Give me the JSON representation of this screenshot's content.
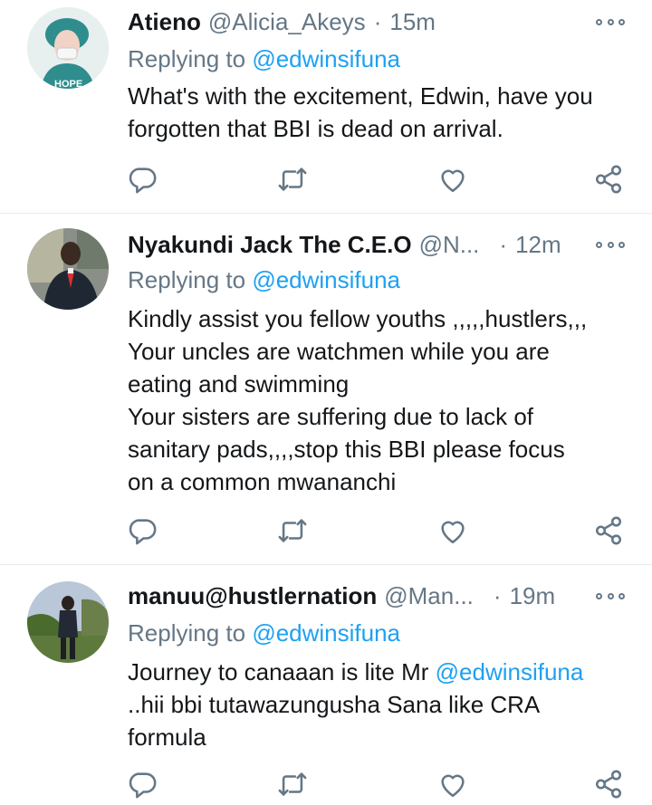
{
  "tweets": [
    {
      "name": "Atieno",
      "handle": "@Alicia_Akeys",
      "separator": "·",
      "time": "15m",
      "replying_prefix": "Replying to",
      "replying_to": "@edwinsifuna",
      "body_lines": [
        "What's with the excitement, Edwin, have you",
        "forgotten that BBI is dead on arrival."
      ],
      "avatar_badge": "HOPE"
    },
    {
      "name": "Nyakundi Jack The C.E.O",
      "handle": "@N...",
      "separator": "·",
      "time": "12m",
      "replying_prefix": "Replying to",
      "replying_to": "@edwinsifuna",
      "body_lines": [
        "Kindly assist you fellow youths ,,,,,hustlers,,,",
        "Your uncles are watchmen while you are",
        "eating and swimming",
        "Your sisters are suffering due to lack of",
        "sanitary pads,,,,stop this BBI please focus",
        "on a common mwananchi"
      ]
    },
    {
      "name": "manuu@hustlernation",
      "handle": "@Man...",
      "separator": "·",
      "time": "19m",
      "replying_prefix": "Replying to",
      "replying_to": "@edwinsifuna",
      "body_line1_text": "Journey to canaaan is lite Mr ",
      "body_line1_mention": "@edwinsifuna",
      "body_lines_rest": [
        "..hii bbi tutawazungusha Sana like CRA",
        "formula"
      ]
    }
  ],
  "icons": {
    "reply": "reply-icon",
    "retweet": "retweet-icon",
    "like": "heart-icon",
    "share": "share-icon",
    "more": "more-options-icon"
  },
  "colors": {
    "icon_gray": "#657786",
    "link_blue": "#1da1f2",
    "text": "#14171a",
    "divider": "#e6ecf0"
  }
}
